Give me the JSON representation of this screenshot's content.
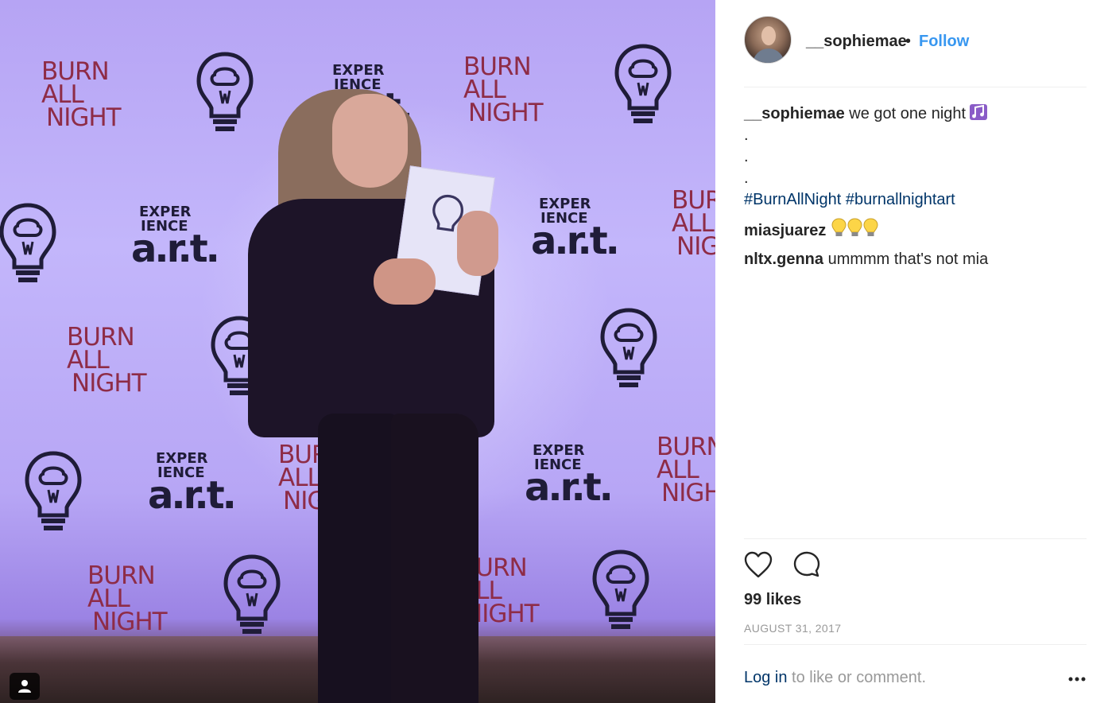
{
  "photo": {
    "backdrop_logo_burn": [
      "BURN",
      "ALL",
      "NIGHT"
    ],
    "backdrop_logo_experience": [
      "EXPER",
      "IENCE",
      "a.r.t."
    ],
    "user_tag_icon": "person-icon"
  },
  "post_header": {
    "username": "__sophiemae",
    "separator": "•",
    "follow_label": "Follow"
  },
  "caption": {
    "username": "__sophiemae",
    "text": "we got one night",
    "emoji": "music-notes-emoji",
    "dots": [
      ".",
      ".",
      "."
    ],
    "hashtags": [
      "#BurnAllNight",
      "#burnallnightart"
    ]
  },
  "comments": [
    {
      "username": "miasjuarez",
      "text": "",
      "emoji": "light-bulb-emoji x3"
    },
    {
      "username": "nltx.genna",
      "text": "ummmm that's not mia"
    }
  ],
  "actions": {
    "like_icon": "heart-icon",
    "comment_icon": "comment-bubble-icon"
  },
  "likes": "99 likes",
  "date": "AUGUST 31, 2017",
  "footer": {
    "login_link": "Log in",
    "login_suffix": " to like or comment.",
    "more_icon": "more-options-icon"
  },
  "colors": {
    "link_blue": "#3897f0",
    "hashtag": "#003569",
    "muted": "#999999",
    "text": "#262626",
    "backdrop_purple": "#b6a4f4",
    "logo_red": "#8e2c47"
  }
}
